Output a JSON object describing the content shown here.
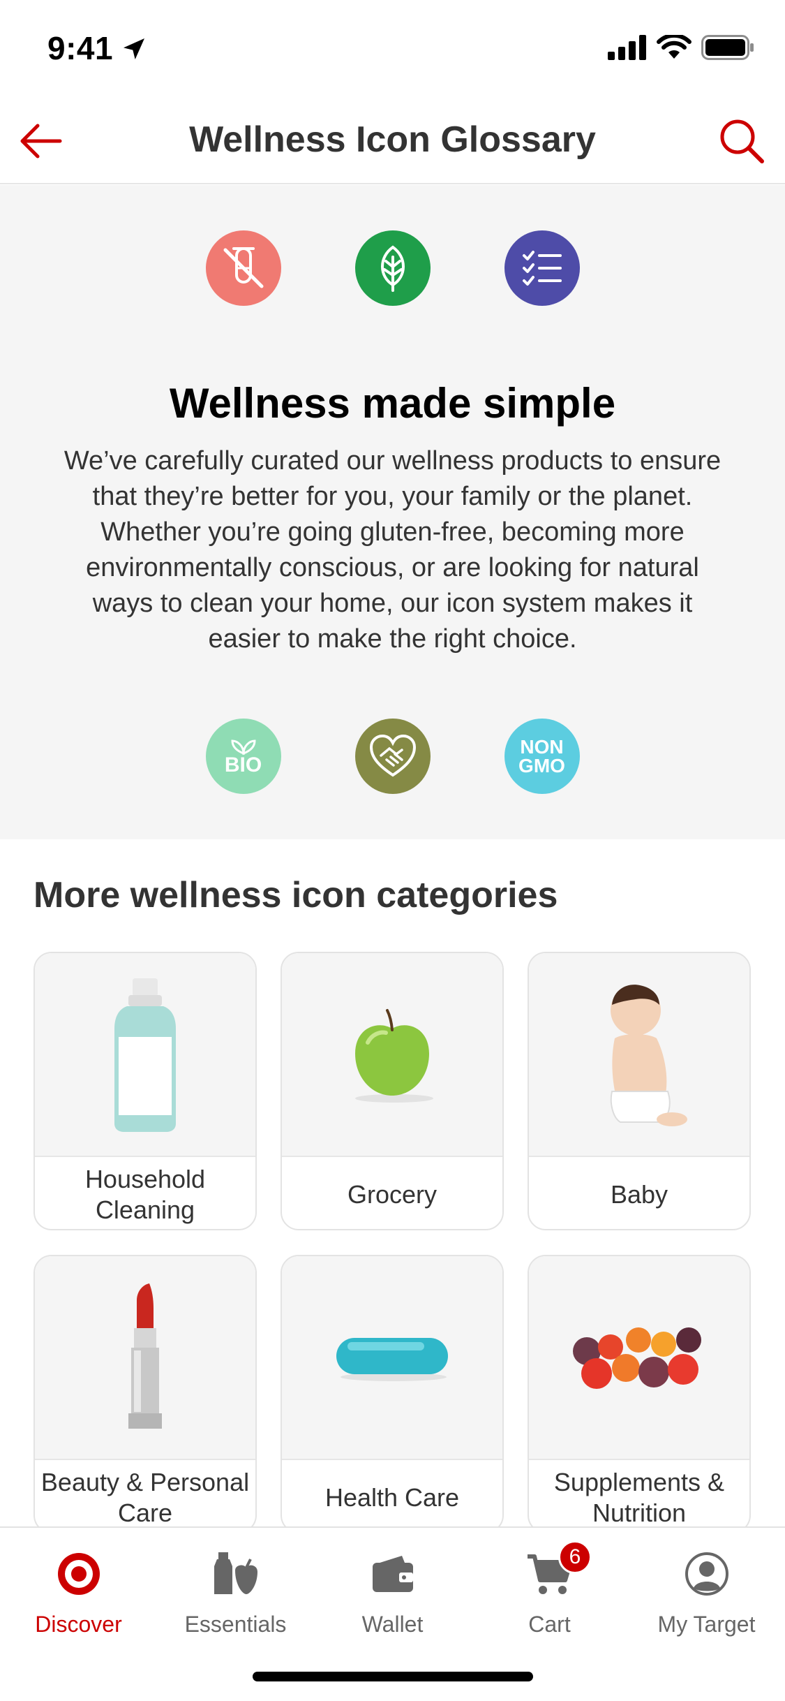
{
  "status_bar": {
    "time": "9:41"
  },
  "header": {
    "title": "Wellness Icon Glossary"
  },
  "hero": {
    "heading": "Wellness made simple",
    "body": "We’ve carefully curated our wellness products to ensure that they’re better for you, your family or the planet. Whether you’re going gluten-free, becoming more environmentally conscious, or are looking for natural ways to clean your home, our icon system makes it easier to make the right choice.",
    "icons_top": [
      {
        "icon": "no-test-tube-icon",
        "color": "#f07a72"
      },
      {
        "icon": "leaf-icon",
        "color": "#1f9e4a"
      },
      {
        "icon": "checklist-icon",
        "color": "#4e4ca8"
      }
    ],
    "icons_bottom": [
      {
        "icon": "bio-icon",
        "color": "#8fdcb4",
        "text": "BIO"
      },
      {
        "icon": "heart-handshake-icon",
        "color": "#858a45"
      },
      {
        "icon": "non-gmo-icon",
        "color": "#5ccde0",
        "text_line1": "NON",
        "text_line2": "GMO"
      }
    ]
  },
  "categories": {
    "title": "More wellness icon categories",
    "items": [
      {
        "label": "Household Cleaning",
        "icon": "cleaning-bottle-icon"
      },
      {
        "label": "Grocery",
        "icon": "apple-icon"
      },
      {
        "label": "Baby",
        "icon": "baby-icon"
      },
      {
        "label": "Beauty & Personal Care",
        "icon": "lipstick-icon"
      },
      {
        "label": "Health Care",
        "icon": "capsule-icon"
      },
      {
        "label": "Supplements & Nutrition",
        "icon": "gummies-icon"
      }
    ]
  },
  "tabbar": {
    "tabs": [
      {
        "label": "Discover",
        "icon": "target-logo-icon",
        "active": true
      },
      {
        "label": "Essentials",
        "icon": "essentials-icon",
        "active": false
      },
      {
        "label": "Wallet",
        "icon": "wallet-icon",
        "active": false
      },
      {
        "label": "Cart",
        "icon": "cart-icon",
        "active": false,
        "badge": "6"
      },
      {
        "label": "My Target",
        "icon": "profile-icon",
        "active": false
      }
    ]
  },
  "colors": {
    "accent": "#cc0000",
    "hero_bg": "#f5f5f5",
    "text": "#333333"
  }
}
